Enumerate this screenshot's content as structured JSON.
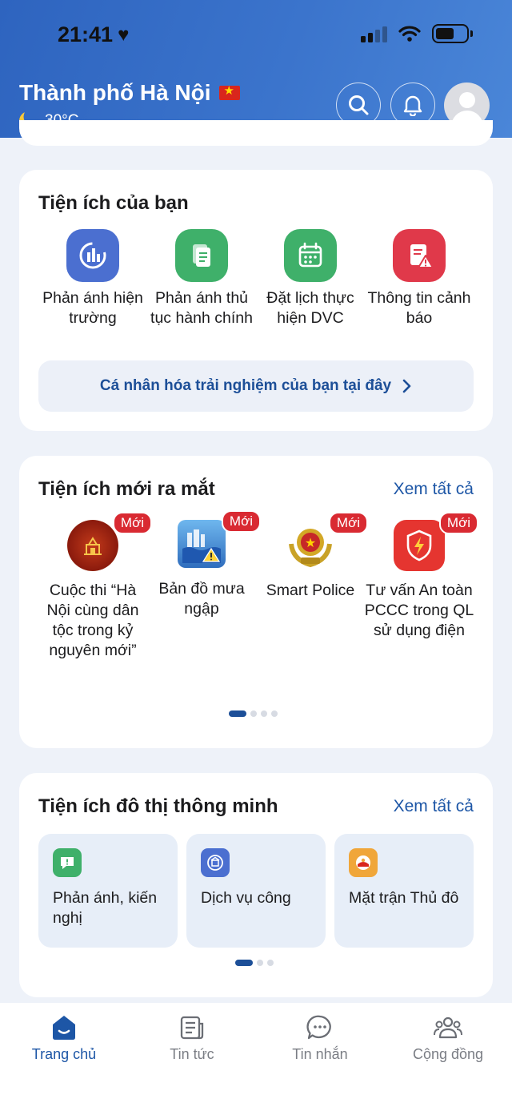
{
  "status_bar": {
    "time": "21:41"
  },
  "header": {
    "city": "Thành phố Hà Nội",
    "temperature": "30°C"
  },
  "utilities": {
    "title": "Tiện ích của bạn",
    "items": [
      {
        "label": "Phản ánh hiện trường",
        "icon": "report-scene-icon",
        "color": "#4b6fd0"
      },
      {
        "label": "Phản ánh thủ tục hành chính",
        "icon": "document-icon",
        "color": "#3fb06a"
      },
      {
        "label": "Đặt lịch thực hiện DVC",
        "icon": "calendar-icon",
        "color": "#3fb06a"
      },
      {
        "label": "Thông tin cảnh báo",
        "icon": "warning-doc-icon",
        "color": "#e0394a"
      }
    ],
    "personalize_label": "Cá nhân hóa trải nghiệm của bạn tại đây"
  },
  "new_utilities": {
    "title": "Tiện ích mới ra mắt",
    "see_all": "Xem tất cả",
    "badge": "Mới",
    "items": [
      {
        "label": "Cuộc thi “Hà Nội cùng dân tộc trong kỷ nguyên mới”",
        "icon": "contest-emblem-icon"
      },
      {
        "label": "Bản đồ mưa ngập",
        "icon": "flood-map-icon"
      },
      {
        "label": "Smart Police",
        "icon": "police-emblem-icon"
      },
      {
        "label": "Tư vấn An toàn PCCC trong QL sử dụng điện",
        "icon": "fire-safety-icon"
      }
    ]
  },
  "smart_city": {
    "title": "Tiện ích đô thị thông minh",
    "see_all": "Xem tất cả",
    "items": [
      {
        "label": "Phản ánh, kiến nghị",
        "icon": "feedback-icon",
        "color": "#3fb06a"
      },
      {
        "label": "Dịch vụ công",
        "icon": "public-service-icon",
        "color": "#4b6fd0"
      },
      {
        "label": "Mặt trận Thủ đô",
        "icon": "front-icon",
        "color": "#f0a63a"
      }
    ]
  },
  "tabbar": {
    "tabs": [
      {
        "label": "Trang chủ",
        "icon": "home-icon",
        "active": true
      },
      {
        "label": "Tin tức",
        "icon": "news-icon"
      },
      {
        "label": "Tin nhắn",
        "icon": "chat-icon"
      },
      {
        "label": "Cộng đồng",
        "icon": "community-icon"
      }
    ]
  },
  "colors": {
    "accent": "#1d56a6",
    "header": "#3b74cc",
    "badge": "#d92a32"
  }
}
